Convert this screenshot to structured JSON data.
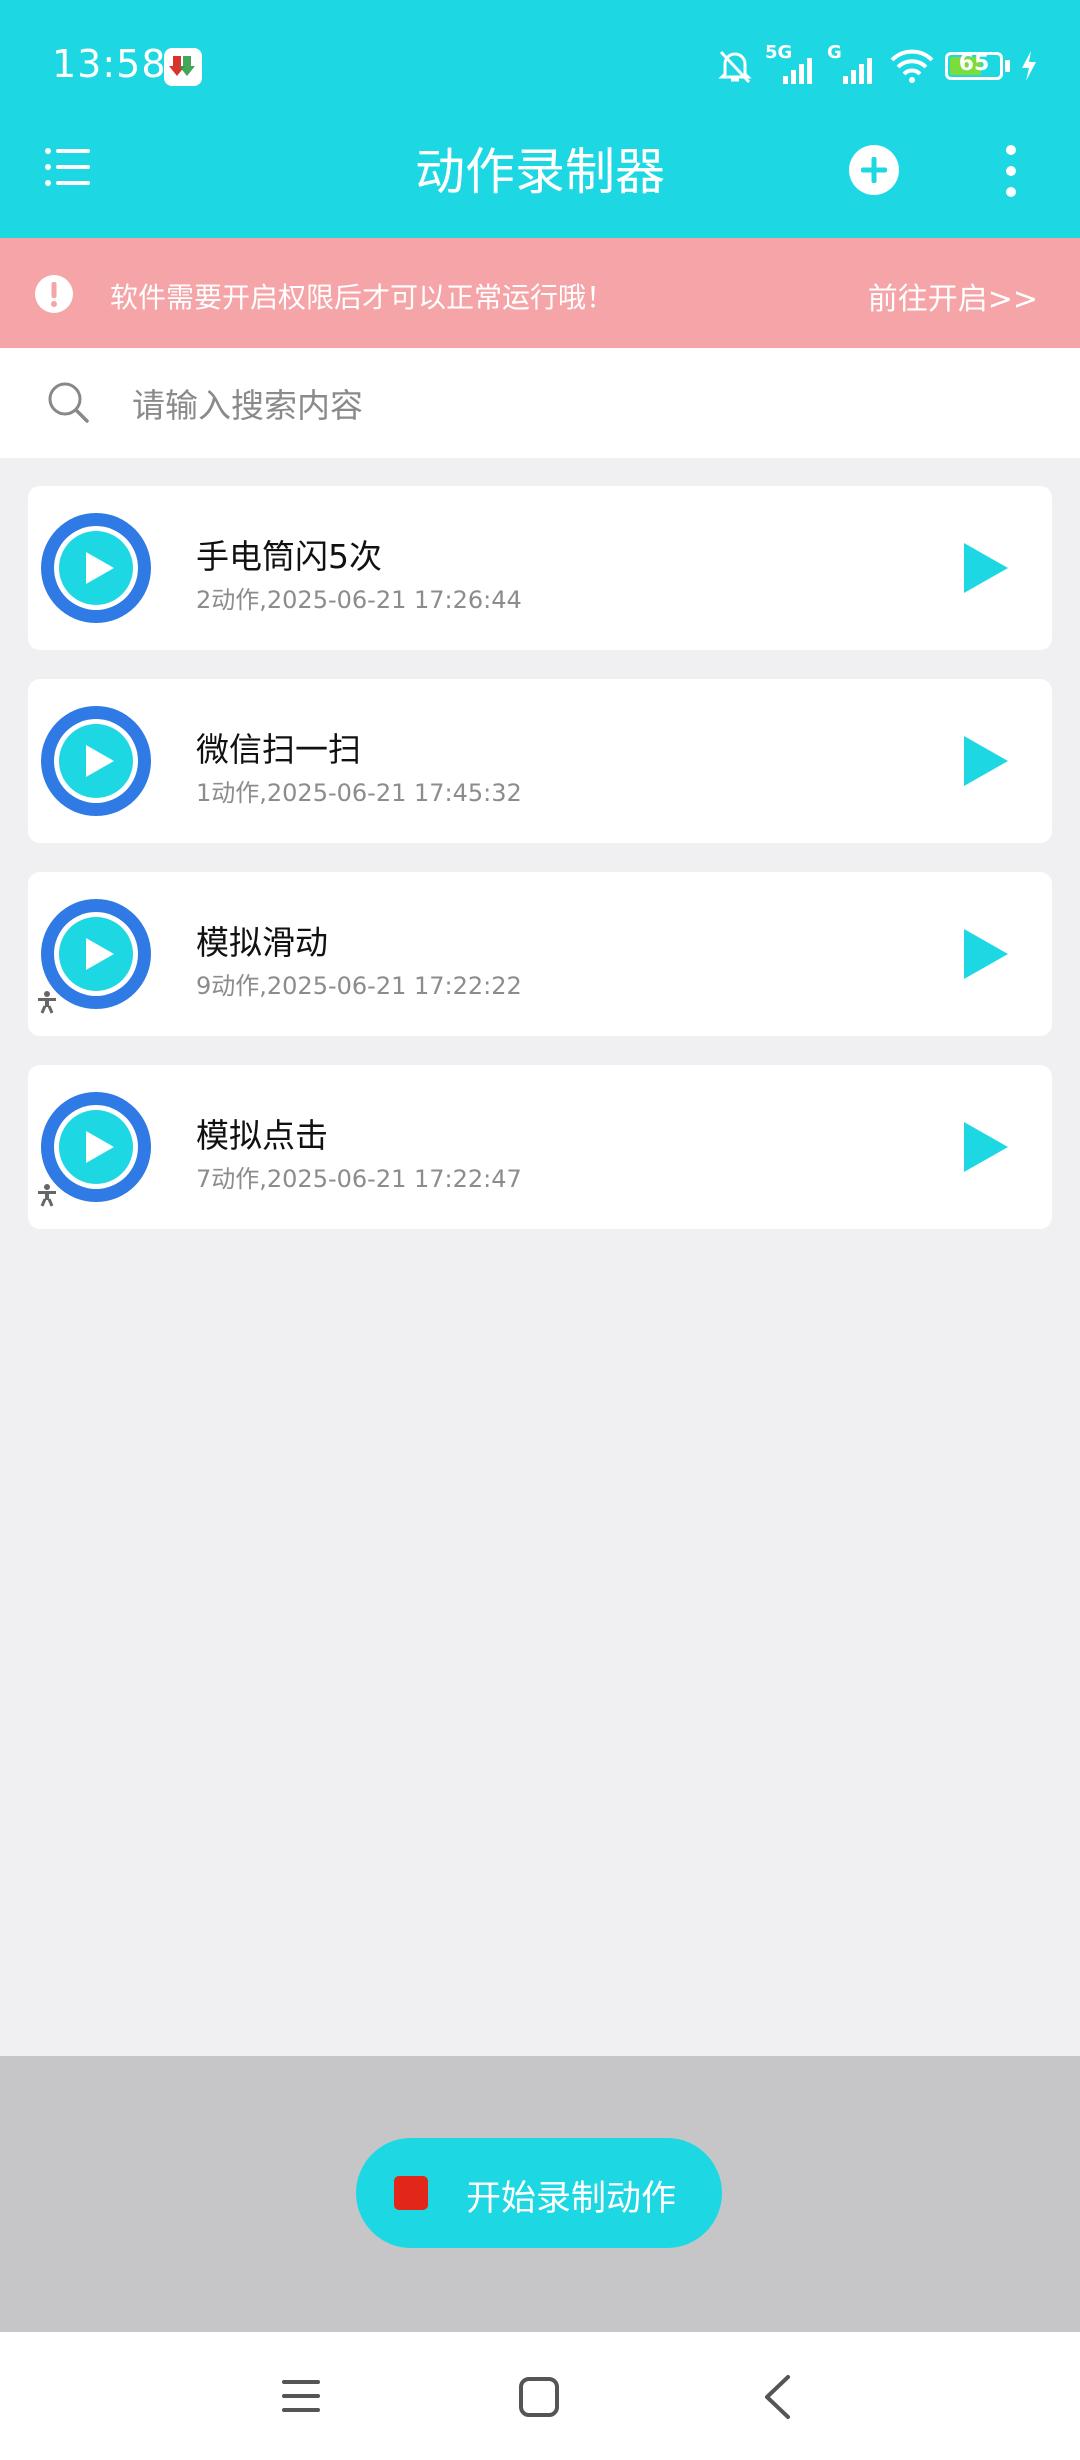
{
  "status_bar": {
    "time": "13:58",
    "signal_1_label": "5G",
    "signal_2_label": "G",
    "battery": "65",
    "battery_level": 0.65
  },
  "app_bar": {
    "title": "动作录制器",
    "menu_icon": "list-icon",
    "add_icon": "plus-circle-icon",
    "more_icon": "more-vertical-icon"
  },
  "permission_banner": {
    "message": "软件需要开启权限后才可以正常运行哦！",
    "action": "前往开启>>"
  },
  "search": {
    "placeholder": "请输入搜索内容"
  },
  "recordings": [
    {
      "title": "手电筒闪5次",
      "subtitle": "2动作,2025-06-21 17:26:44",
      "accessibility_badge": false
    },
    {
      "title": "微信扫一扫",
      "subtitle": "1动作,2025-06-21 17:45:32",
      "accessibility_badge": false
    },
    {
      "title": "模拟滑动",
      "subtitle": "9动作,2025-06-21 17:22:22",
      "accessibility_badge": true
    },
    {
      "title": "模拟点击",
      "subtitle": "7动作,2025-06-21 17:22:47",
      "accessibility_badge": true
    }
  ],
  "record_button": {
    "label": "开始录制动作"
  },
  "colors": {
    "primary": "#1dd8e3",
    "banner": "#f5a5a8",
    "avatar_ring": "#2f7ae5",
    "record_dot": "#e2261a"
  }
}
